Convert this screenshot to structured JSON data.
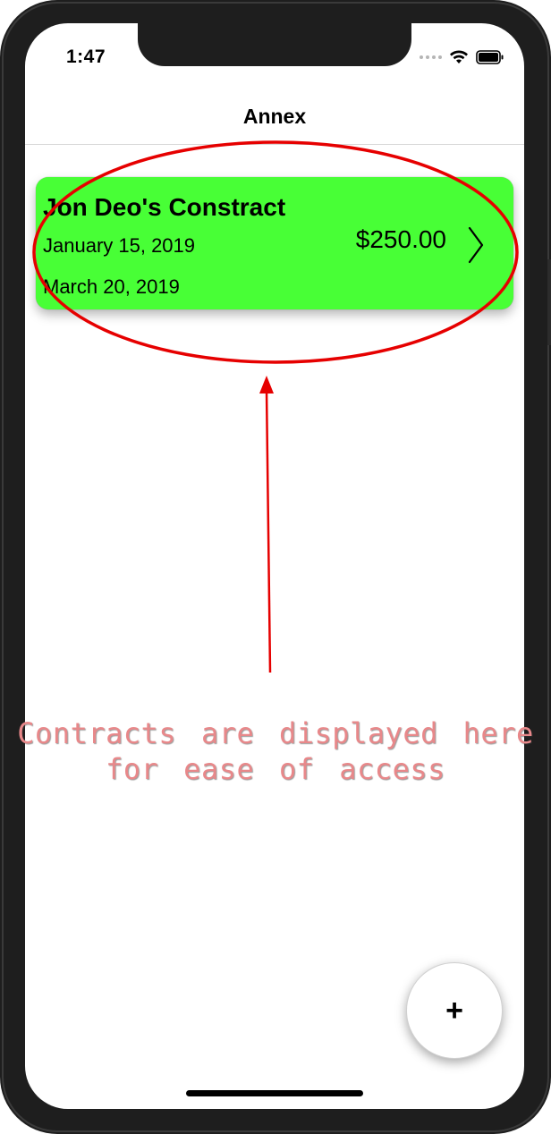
{
  "status_bar": {
    "time": "1:47"
  },
  "nav": {
    "title": "Annex"
  },
  "contract": {
    "title": "Jon Deo's Constract",
    "start_date": "January 15, 2019",
    "end_date": "March 20, 2019",
    "amount": "$250.00",
    "color": "#48ff36"
  },
  "fab": {
    "label": "+"
  },
  "annotation": {
    "line1": "Contracts are displayed here",
    "line2": "for ease of access",
    "color": "#e60000"
  }
}
